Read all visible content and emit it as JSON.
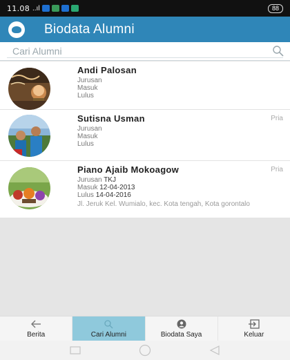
{
  "status_bar": {
    "time": "11.08",
    "signal": "..ıl",
    "battery": "88"
  },
  "app_bar": {
    "title": "Biodata Alumni",
    "logo_icon": "graduation-cap-icon"
  },
  "search": {
    "placeholder": "Cari Alumni",
    "value": ""
  },
  "alumni": [
    {
      "name": "Andi Palosan",
      "gender": "",
      "jurusan_label": "Jurusan",
      "jurusan_value": "",
      "masuk_label": "Masuk",
      "masuk_value": "",
      "lulus_label": "Lulus",
      "lulus_value": "",
      "address": ""
    },
    {
      "name": "Sutisna Usman",
      "gender": "Pria",
      "jurusan_label": "Jurusan",
      "jurusan_value": "",
      "masuk_label": "Masuk",
      "masuk_value": "",
      "lulus_label": "Lulus",
      "lulus_value": "",
      "address": ""
    },
    {
      "name": "Piano Ajaib Mokoagow",
      "gender": "Pria",
      "jurusan_label": "Jurusan",
      "jurusan_value": "TKJ",
      "masuk_label": "Masuk",
      "masuk_value": "12-04-2013",
      "lulus_label": "Lulus",
      "lulus_value": "14-04-2016",
      "address": "Jl. Jeruk Kel. Wumialo, kec. Kota tengah, Kota gorontalo"
    }
  ],
  "bottom_nav": [
    {
      "label": "Berita",
      "icon": "arrow-left-icon",
      "active": false
    },
    {
      "label": "Cari Alumni",
      "icon": "search-icon",
      "active": true
    },
    {
      "label": "Biodata Saya",
      "icon": "account-icon",
      "active": false
    },
    {
      "label": "Keluar",
      "icon": "exit-icon",
      "active": false
    }
  ],
  "colors": {
    "primary": "#2f86b8",
    "active_tab": "#8fc9dc"
  }
}
